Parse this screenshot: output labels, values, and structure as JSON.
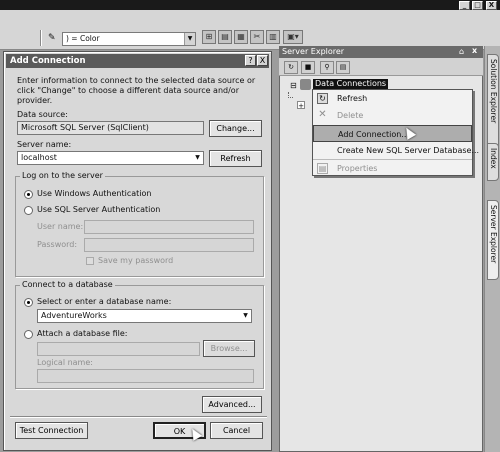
{
  "toolbar": {
    "property_combo": ") = Color",
    "icons": [
      "property-icon",
      "grid-icon",
      "properties-icon",
      "toolbox-icon",
      "tools-icon",
      "data-icon",
      "layout-icon"
    ]
  },
  "dialog": {
    "title": "Add Connection",
    "help_btn": "?",
    "close_btn": "X",
    "intro": "Enter information to connect to the selected data source or click \"Change\" to choose a different data source and/or provider.",
    "data_source_label": "Data source:",
    "data_source_value": "Microsoft SQL Server (SqlClient)",
    "change_btn": "Change...",
    "server_name_label": "Server name:",
    "server_name_value": "localhost",
    "refresh_btn": "Refresh",
    "logon_group": "Log on to the server",
    "windows_auth": "Use Windows Authentication",
    "sql_auth": "Use SQL Server Authentication",
    "user_name_label": "User name:",
    "password_label": "Password:",
    "save_password": "Save my password",
    "connect_group": "Connect to a database",
    "select_db_label": "Select or enter a database name:",
    "db_value": "AdventureWorks",
    "attach_label": "Attach a database file:",
    "browse_btn": "Browse...",
    "logical_name_label": "Logical name:",
    "advanced_btn": "Advanced...",
    "test_btn": "Test Connection",
    "ok_btn": "OK",
    "cancel_btn": "Cancel"
  },
  "server_explorer": {
    "title": "Server Explorer",
    "pin": "⌂",
    "close": "x",
    "tree_root": "Data Connections",
    "context_menu": {
      "refresh": "Refresh",
      "delete": "Delete",
      "add_connection": "Add Connection...",
      "create_db": "Create New SQL Server Database...",
      "properties": "Properties"
    }
  },
  "side_tabs": [
    "Solution Explorer",
    "Index",
    "Server Explorer"
  ],
  "window_controls": [
    "_",
    "□",
    "X"
  ]
}
